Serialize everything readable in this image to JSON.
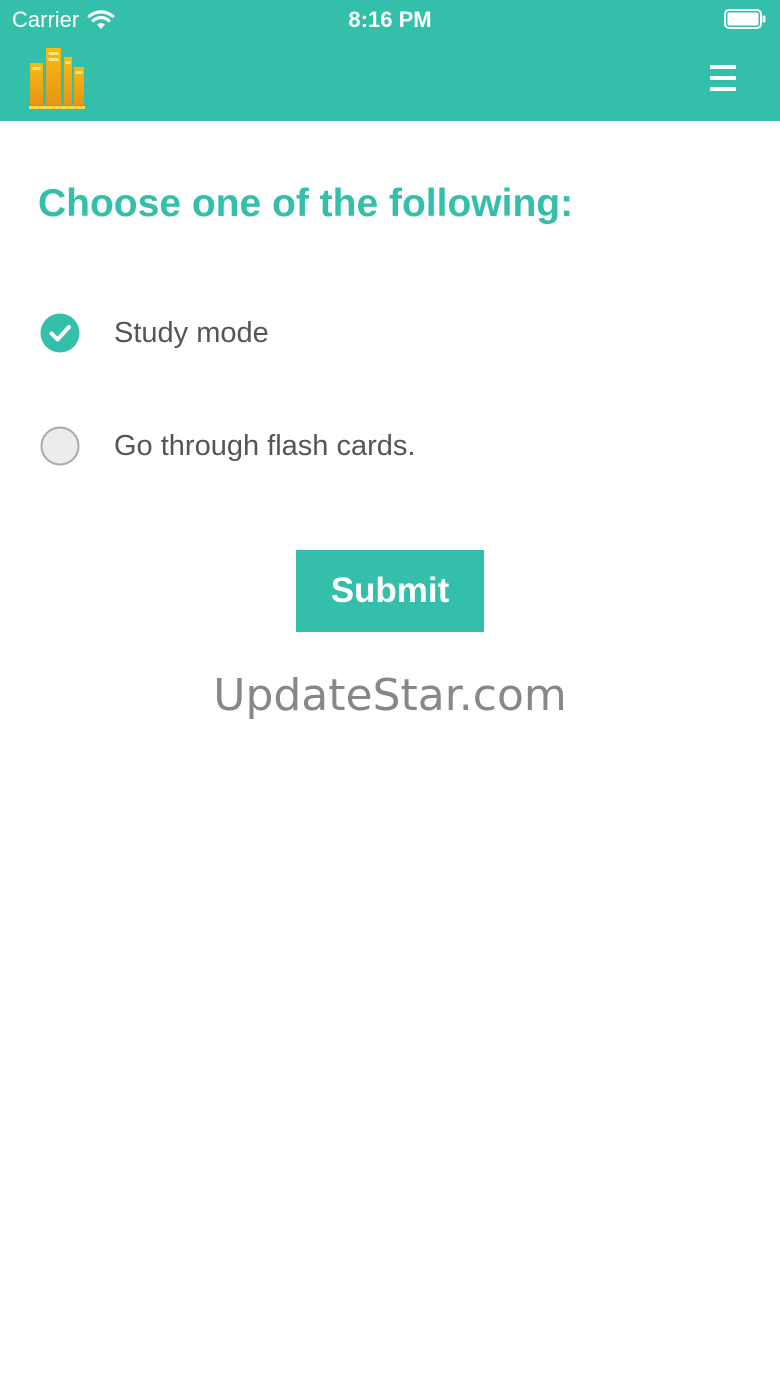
{
  "status_bar": {
    "carrier": "Carrier",
    "time": "8:16 PM",
    "wifi_icon": "wifi-icon",
    "battery_icon": "battery-full-icon"
  },
  "header": {
    "logo_icon": "books-logo-icon",
    "menu_icon": "hamburger-menu-icon",
    "background_color": "#33bfaa"
  },
  "main": {
    "title": "Choose one of the following:",
    "options": [
      {
        "label": "Study mode",
        "selected": true
      },
      {
        "label": "Go through flash cards.",
        "selected": false
      }
    ],
    "submit_label": "Submit",
    "accent_color": "#33bfaa"
  },
  "watermark": "UpdateStar.com"
}
